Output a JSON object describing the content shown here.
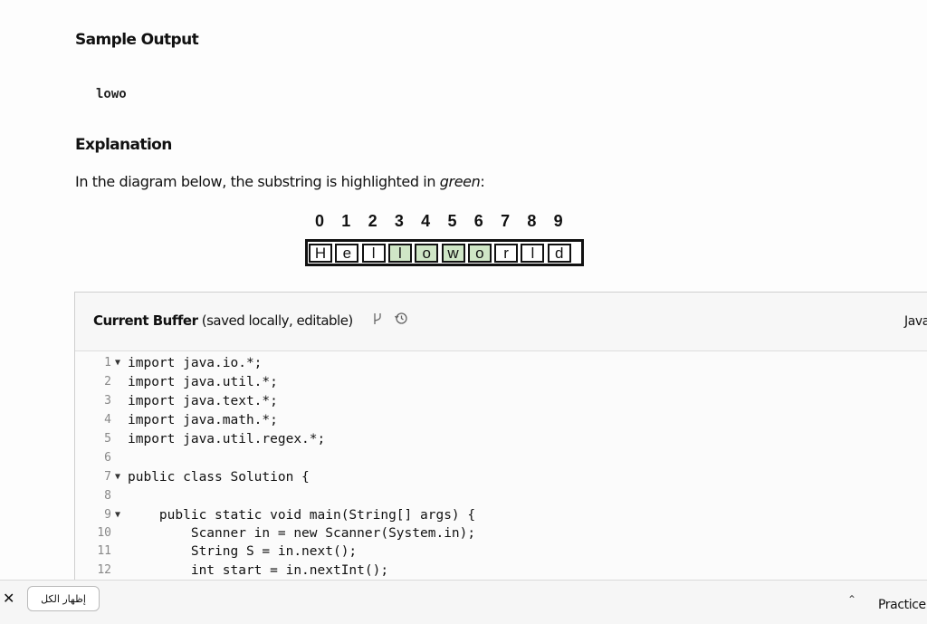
{
  "sample_output": {
    "title": "Sample Output",
    "value": "lowo"
  },
  "explanation": {
    "title": "Explanation",
    "text_before": "In the diagram below, the substring is highlighted in ",
    "text_emphasis": "green",
    "text_after": ":"
  },
  "diagram": {
    "indices": [
      "0",
      "1",
      "2",
      "3",
      "4",
      "5",
      "6",
      "7",
      "8",
      "9"
    ],
    "chars": [
      "H",
      "e",
      "l",
      "l",
      "o",
      "w",
      "o",
      "r",
      "l",
      "d"
    ],
    "highlighted_range": [
      3,
      6
    ],
    "highlight_color": "#cfe6c6"
  },
  "editor": {
    "buffer_title_bold": "Current Buffer",
    "buffer_title_rest": " (saved locally, editable)",
    "language": "Java",
    "lines": [
      {
        "num": "1",
        "fold": true,
        "text": "import java.io.*;"
      },
      {
        "num": "2",
        "fold": false,
        "text": "import java.util.*;"
      },
      {
        "num": "3",
        "fold": false,
        "text": "import java.text.*;"
      },
      {
        "num": "4",
        "fold": false,
        "text": "import java.math.*;"
      },
      {
        "num": "5",
        "fold": false,
        "text": "import java.util.regex.*;"
      },
      {
        "num": "6",
        "fold": false,
        "text": ""
      },
      {
        "num": "7",
        "fold": true,
        "text": "public class Solution {"
      },
      {
        "num": "8",
        "fold": false,
        "text": ""
      },
      {
        "num": "9",
        "fold": true,
        "text": "    public static void main(String[] args) {"
      },
      {
        "num": "10",
        "fold": false,
        "text": "        Scanner in = new Scanner(System.in);"
      },
      {
        "num": "11",
        "fold": false,
        "text": "        String S = in.next();"
      },
      {
        "num": "12",
        "fold": false,
        "text": "        int start = in.nextInt();"
      }
    ]
  },
  "bottom_bar": {
    "show_all_label": "إظهار الكل",
    "practice_label": "Practice"
  },
  "icons": {
    "branch": "branch-icon",
    "history": "history-icon",
    "close": "close-icon",
    "chevron": "chevron-up-icon"
  }
}
